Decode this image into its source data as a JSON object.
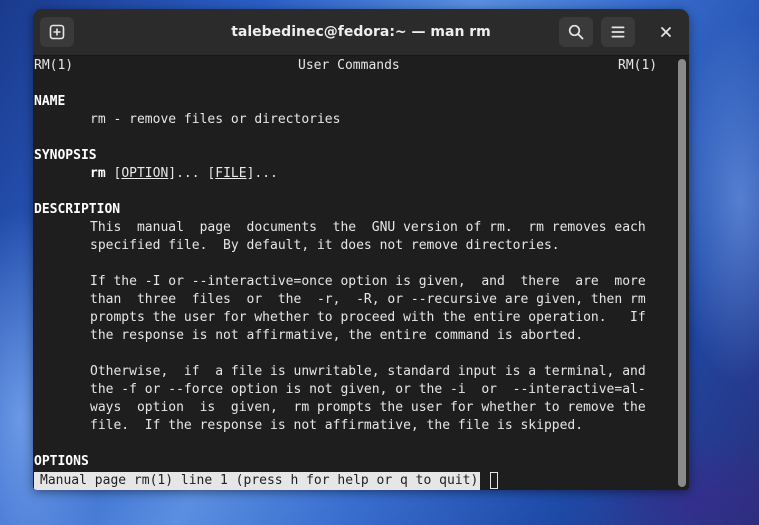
{
  "window": {
    "title": "talebedinec@fedora:~ — man rm",
    "buttons": {
      "new_tab": "new-tab-icon",
      "search": "search-icon",
      "menu": "hamburger-menu-icon",
      "close": "close-icon"
    }
  },
  "man": {
    "header_left": "RM(1)",
    "header_center": "User Commands",
    "header_right": "RM(1)",
    "name_heading": "NAME",
    "name_text": "rm - remove files or directories",
    "synopsis_heading": "SYNOPSIS",
    "synopsis_cmd": "rm",
    "synopsis_option": "OPTION",
    "synopsis_file": "FILE",
    "description_heading": "DESCRIPTION",
    "description_para1": [
      "This  manual  page  documents  the  GNU version of rm.  rm removes each",
      "specified file.  By default, it does not remove directories."
    ],
    "description_para2": [
      "If the -I or --interactive=once option is given,  and  there  are  more",
      "than  three  files  or  the  -r,  -R, or --recursive are given, then rm",
      "prompts the user for whether to proceed with the entire operation.   If",
      "the response is not affirmative, the entire command is aborted."
    ],
    "description_para3": [
      "Otherwise,  if  a file is unwritable, standard input is a terminal, and",
      "the -f or --force option is not given, or the -i  or  --interactive=al‐",
      "ways  option  is  given,  rm prompts the user for whether to remove the",
      "file.  If the response is not affirmative, the file is skipped."
    ],
    "options_heading": "OPTIONS"
  },
  "status_bar": "Manual page rm(1) line 1 (press h for help or q to quit)"
}
